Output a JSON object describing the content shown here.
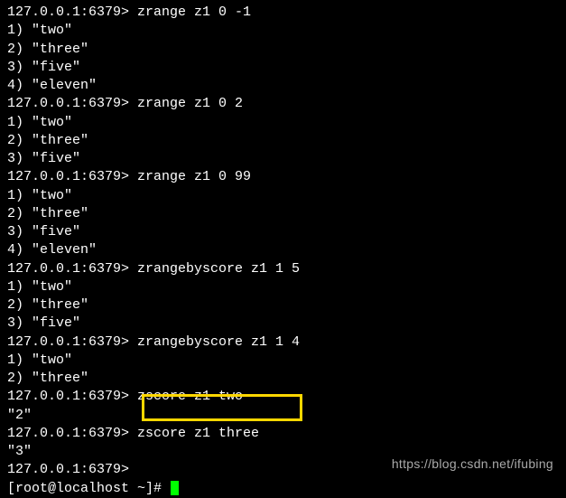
{
  "lines": [
    {
      "prompt": "127.0.0.1:6379>",
      "command": " zrange z1 0 -1"
    },
    {
      "text": "1) \"two\""
    },
    {
      "text": "2) \"three\""
    },
    {
      "text": "3) \"five\""
    },
    {
      "text": "4) \"eleven\""
    },
    {
      "prompt": "127.0.0.1:6379>",
      "command": " zrange z1 0 2"
    },
    {
      "text": "1) \"two\""
    },
    {
      "text": "2) \"three\""
    },
    {
      "text": "3) \"five\""
    },
    {
      "prompt": "127.0.0.1:6379>",
      "command": " zrange z1 0 99"
    },
    {
      "text": "1) \"two\""
    },
    {
      "text": "2) \"three\""
    },
    {
      "text": "3) \"five\""
    },
    {
      "text": "4) \"eleven\""
    },
    {
      "prompt": "127.0.0.1:6379>",
      "command": " zrangebyscore z1 1 5"
    },
    {
      "text": "1) \"two\""
    },
    {
      "text": "2) \"three\""
    },
    {
      "text": "3) \"five\""
    },
    {
      "prompt": "127.0.0.1:6379>",
      "command": " zrangebyscore z1 1 4"
    },
    {
      "text": "1) \"two\""
    },
    {
      "text": "2) \"three\""
    },
    {
      "prompt": "127.0.0.1:6379>",
      "command": " zscore z1 two"
    },
    {
      "text": "\"2\""
    },
    {
      "prompt": "127.0.0.1:6379>",
      "command": " zscore z1 three"
    },
    {
      "text": "\"3\""
    },
    {
      "prompt": "127.0.0.1:6379>",
      "command": ""
    },
    {
      "shellprompt": "[root@localhost ~]# ",
      "cursor": true
    }
  ],
  "watermark": "https://blog.csdn.net/ifubing"
}
